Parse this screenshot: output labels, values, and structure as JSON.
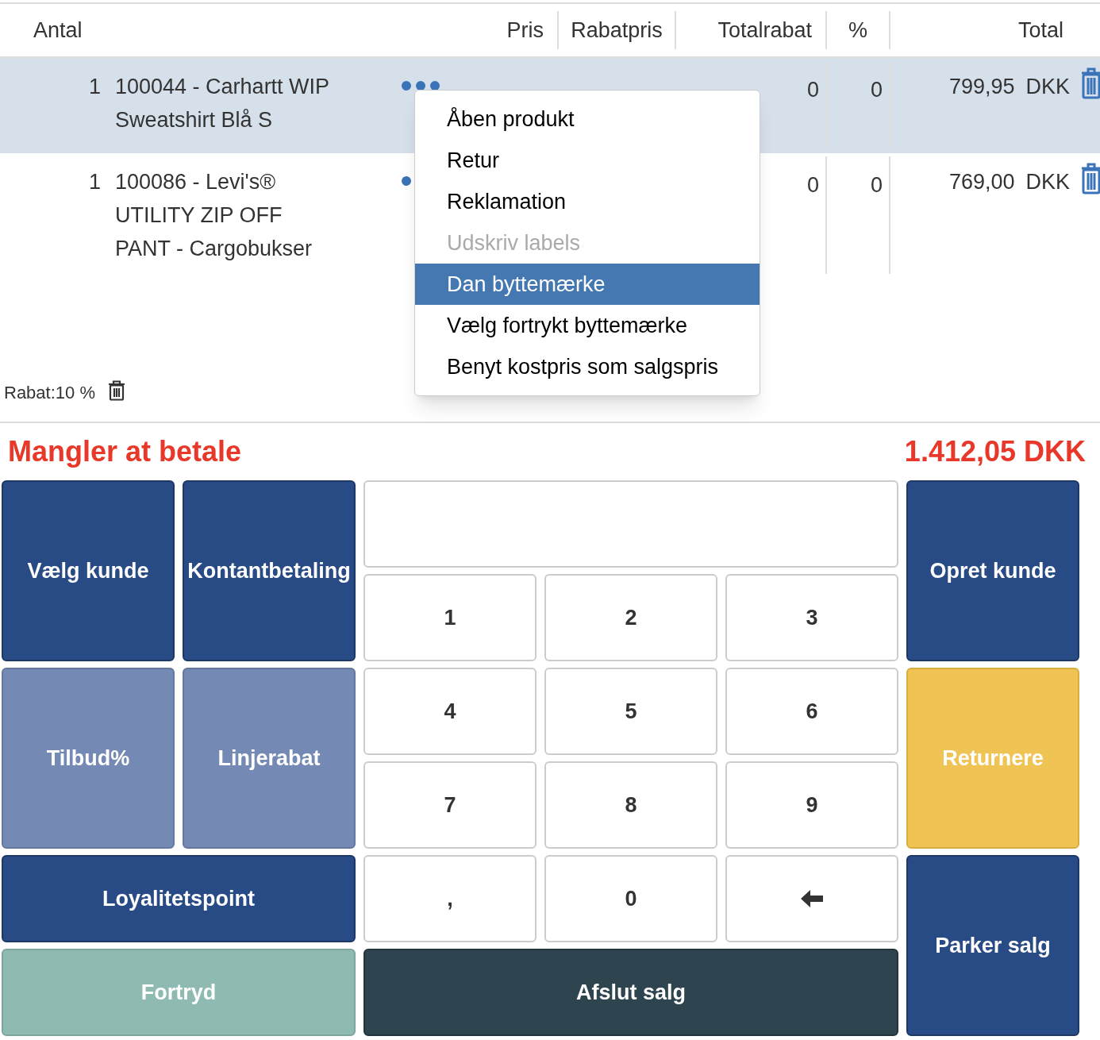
{
  "table": {
    "columns": [
      "Antal",
      "Pris",
      "Rabatpris",
      "Totalrabat",
      "%",
      "Total"
    ],
    "rows": [
      {
        "quantity": "1",
        "product": "100044 - Carhartt WIP Sweatshirt Blå S",
        "total_discount": "0",
        "percent": "0",
        "total": "799,95",
        "currency": "DKK",
        "selected": true
      },
      {
        "quantity": "1",
        "product": "100086 - Levi's® UTILITY ZIP OFF PANT - Cargobukser",
        "total_discount": "0",
        "percent": "0",
        "total": "769,00",
        "currency": "DKK",
        "selected": false
      }
    ]
  },
  "context_menu": [
    {
      "label": "Åben produkt",
      "selected": false,
      "disabled": false
    },
    {
      "label": "Retur",
      "selected": false,
      "disabled": false
    },
    {
      "label": "Reklamation",
      "selected": false,
      "disabled": false
    },
    {
      "label": "Udskriv labels",
      "selected": false,
      "disabled": true
    },
    {
      "label": "Dan byttemærke",
      "selected": true,
      "disabled": false
    },
    {
      "label": "Vælg fortrykt byttemærke",
      "selected": false,
      "disabled": false
    },
    {
      "label": "Benyt kostpris som salgspris",
      "selected": false,
      "disabled": false
    }
  ],
  "discount": "Rabat:10 %",
  "due": {
    "label": "Mangler at betale",
    "amount": "1.412,05 DKK"
  },
  "keypad": [
    {
      "kind": "primary",
      "label": "Vælg kunde"
    },
    {
      "kind": "primary",
      "label": "Kontantbetaling"
    },
    {
      "kind": "display"
    },
    {
      "kind": "primary",
      "label": "Opret kunde"
    },
    {
      "kind": "key",
      "label": "1"
    },
    {
      "kind": "key",
      "label": "2"
    },
    {
      "kind": "key",
      "label": "3"
    },
    {
      "kind": "secondary",
      "label": "Tilbud%"
    },
    {
      "kind": "secondary",
      "label": "Linjerabat"
    },
    {
      "kind": "key",
      "label": "4"
    },
    {
      "kind": "key",
      "label": "5"
    },
    {
      "kind": "key",
      "label": "6"
    },
    {
      "kind": "warning",
      "label": "Returnere"
    },
    {
      "kind": "key",
      "label": "7"
    },
    {
      "kind": "key",
      "label": "8"
    },
    {
      "kind": "key",
      "label": "9"
    },
    {
      "kind": "primary",
      "label": "Loyalitetspoint"
    },
    {
      "kind": "key",
      "label": ","
    },
    {
      "kind": "key",
      "label": "0"
    },
    {
      "kind": "backspace"
    },
    {
      "kind": "primary",
      "label": "Parker salg"
    },
    {
      "kind": "muted",
      "label": "Fortryd"
    },
    {
      "kind": "dark",
      "label": "Afslut salg"
    }
  ]
}
